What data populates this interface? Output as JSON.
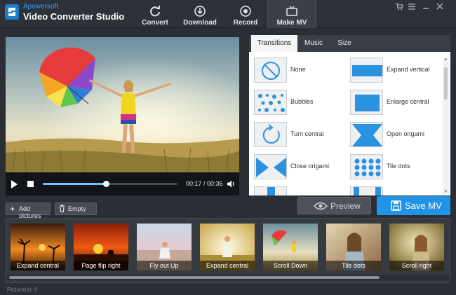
{
  "app": {
    "brand_sub": "Apowersoft",
    "brand_title": "Video Converter Studio"
  },
  "nav": [
    {
      "label": "Convert",
      "icon": "refresh-icon"
    },
    {
      "label": "Download",
      "icon": "download-icon"
    },
    {
      "label": "Record",
      "icon": "record-icon"
    },
    {
      "label": "Make MV",
      "icon": "tv-icon",
      "active": true
    }
  ],
  "window_controls": [
    "cart-icon",
    "settings-icon",
    "minimize-icon",
    "close-icon"
  ],
  "player": {
    "time": "00:17 / 00:36",
    "progress": 0.47
  },
  "panel": {
    "tabs": [
      "Transitions",
      "Music",
      "Size"
    ],
    "active_tab": "Transitions",
    "items": [
      {
        "label": "None",
        "icon": "none-transition-icon"
      },
      {
        "label": "Expand vertical",
        "icon": "expand-vertical-icon"
      },
      {
        "label": "Bubbles",
        "icon": "bubbles-icon"
      },
      {
        "label": "Enlarge central",
        "icon": "enlarge-central-icon"
      },
      {
        "label": "Turn central",
        "icon": "turn-central-icon"
      },
      {
        "label": "Open origami",
        "icon": "open-origami-icon"
      },
      {
        "label": "Close origami",
        "icon": "close-origami-icon"
      },
      {
        "label": "Tile dots",
        "icon": "tile-dots-icon"
      }
    ]
  },
  "actions": {
    "add_pictures": "Add pictures",
    "empty": "Empty",
    "preview": "Preview",
    "save": "Save MV"
  },
  "filmstrip": [
    {
      "caption": "Expand central"
    },
    {
      "caption": "Page flip right"
    },
    {
      "caption": "Fly out Up"
    },
    {
      "caption": "Expand central"
    },
    {
      "caption": "Scroll Down"
    },
    {
      "caption": "Tile dots"
    },
    {
      "caption": "Scroll right"
    }
  ],
  "status": "Picture(s): 9",
  "colors": {
    "accent": "#2294e8",
    "brand_blue": "#2ea2ff"
  }
}
